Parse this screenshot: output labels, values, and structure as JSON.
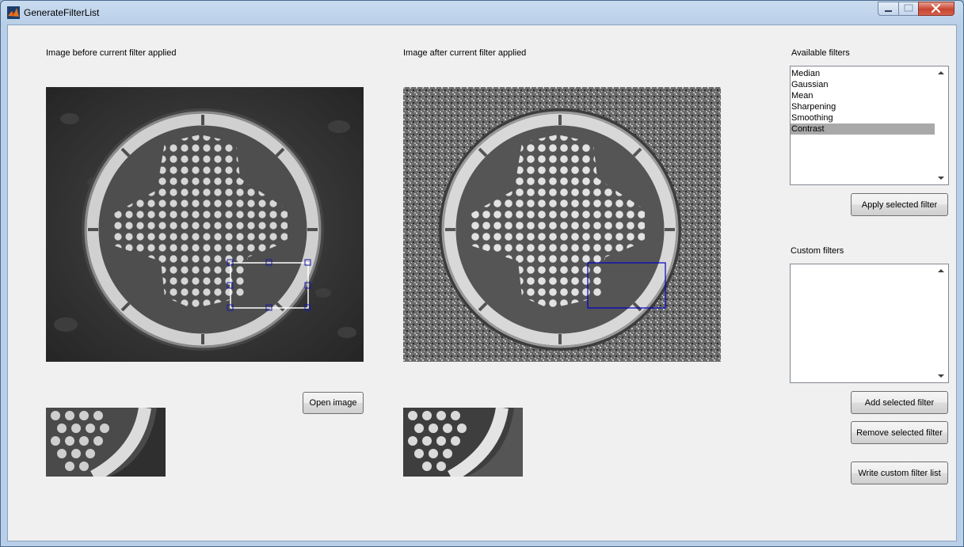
{
  "window": {
    "title": "GenerateFilterList"
  },
  "labels": {
    "before": "Image before current filter applied",
    "after": "Image after current filter applied",
    "available_filters": "Available filters",
    "custom_filters": "Custom filters"
  },
  "available_filters": {
    "items": [
      "Median",
      "Gaussian",
      "Mean",
      "Sharpening",
      "Smoothing",
      "Contrast"
    ],
    "selected": "Contrast"
  },
  "custom_filters": {
    "items": []
  },
  "buttons": {
    "open_image": "Open image",
    "apply_selected_filter": "Apply selected filter",
    "add_selected_filter": "Add selected filter",
    "remove_selected_filter": "Remove selected filter",
    "write_custom_filter_list": "Write custom filter list"
  },
  "colors": {
    "selection": "#a9a9a9",
    "roi_before": "#ffffff",
    "roi_after": "#0000c8",
    "roi_handle": "#1a1aa8",
    "panel_bg": "#f0f0f0"
  }
}
